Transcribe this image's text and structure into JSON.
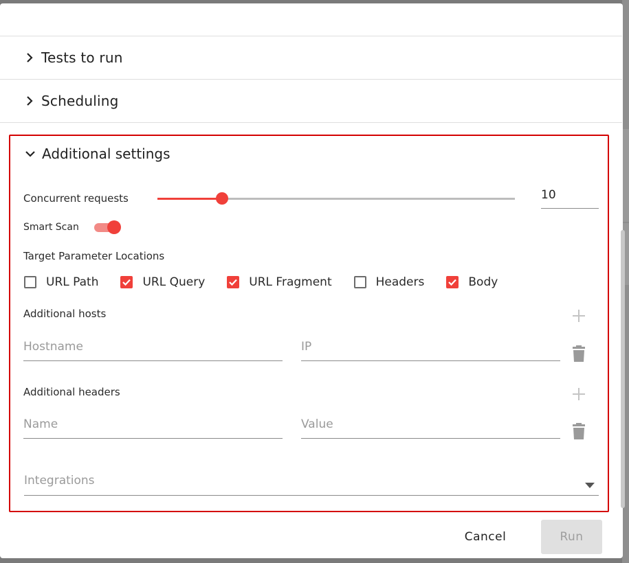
{
  "sections": {
    "tests_to_run": "Tests to run",
    "scheduling": "Scheduling",
    "additional_settings": "Additional settings"
  },
  "concurrent_requests": {
    "label": "Concurrent requests",
    "value": "10",
    "slider_fraction": 0.18
  },
  "smart_scan": {
    "label": "Smart Scan",
    "enabled": true
  },
  "target_parameter_locations": {
    "label": "Target Parameter Locations",
    "options": [
      {
        "label": "URL Path",
        "checked": false
      },
      {
        "label": "URL Query",
        "checked": true
      },
      {
        "label": "URL Fragment",
        "checked": true
      },
      {
        "label": "Headers",
        "checked": false
      },
      {
        "label": "Body",
        "checked": true
      }
    ]
  },
  "additional_hosts": {
    "label": "Additional hosts",
    "hostname_placeholder": "Hostname",
    "ip_placeholder": "IP"
  },
  "additional_headers": {
    "label": "Additional headers",
    "name_placeholder": "Name",
    "value_placeholder": "Value"
  },
  "integrations": {
    "placeholder": "Integrations"
  },
  "actions": {
    "cancel": "Cancel",
    "run": "Run"
  },
  "colors": {
    "accent": "#f0403a",
    "highlight_border": "#d40000",
    "disabled_bg": "#e0e0e0"
  },
  "icons": {
    "collapsed": "chevron-right-icon",
    "expanded": "chevron-down-icon",
    "add": "plus-icon",
    "delete": "trash-icon",
    "dropdown": "caret-down-icon"
  }
}
